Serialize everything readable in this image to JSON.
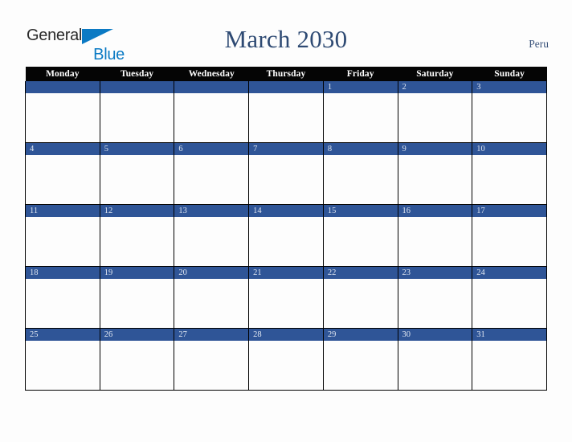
{
  "brand": {
    "name_part1": "General",
    "name_part2": "Blue",
    "triangle_icon": "blue-triangle-icon",
    "color_dark": "#2b2b2b",
    "color_blue": "#0b7ac4"
  },
  "header": {
    "month_title": "March 2030",
    "country": "Peru",
    "title_color": "#2e4a73"
  },
  "calendar": {
    "month": "March",
    "year": "2030",
    "weekday_headers": [
      "Monday",
      "Tuesday",
      "Wednesday",
      "Thursday",
      "Friday",
      "Saturday",
      "Sunday"
    ],
    "header_bg": "#050505",
    "header_text_color": "#ffffff",
    "date_bar_color": "#2f5597",
    "date_text_color": "#dfe6f1",
    "grid_border_color": "#000000",
    "cell_bg": "#fdfdfd",
    "weeks": [
      {
        "days": [
          {
            "date": ""
          },
          {
            "date": ""
          },
          {
            "date": ""
          },
          {
            "date": ""
          },
          {
            "date": "1"
          },
          {
            "date": "2"
          },
          {
            "date": "3"
          }
        ]
      },
      {
        "days": [
          {
            "date": "4"
          },
          {
            "date": "5"
          },
          {
            "date": "6"
          },
          {
            "date": "7"
          },
          {
            "date": "8"
          },
          {
            "date": "9"
          },
          {
            "date": "10"
          }
        ]
      },
      {
        "days": [
          {
            "date": "11"
          },
          {
            "date": "12"
          },
          {
            "date": "13"
          },
          {
            "date": "14"
          },
          {
            "date": "15"
          },
          {
            "date": "16"
          },
          {
            "date": "17"
          }
        ]
      },
      {
        "days": [
          {
            "date": "18"
          },
          {
            "date": "19"
          },
          {
            "date": "20"
          },
          {
            "date": "21"
          },
          {
            "date": "22"
          },
          {
            "date": "23"
          },
          {
            "date": "24"
          }
        ]
      },
      {
        "days": [
          {
            "date": "25"
          },
          {
            "date": "26"
          },
          {
            "date": "27"
          },
          {
            "date": "28"
          },
          {
            "date": "29"
          },
          {
            "date": "30"
          },
          {
            "date": "31"
          }
        ]
      }
    ]
  }
}
